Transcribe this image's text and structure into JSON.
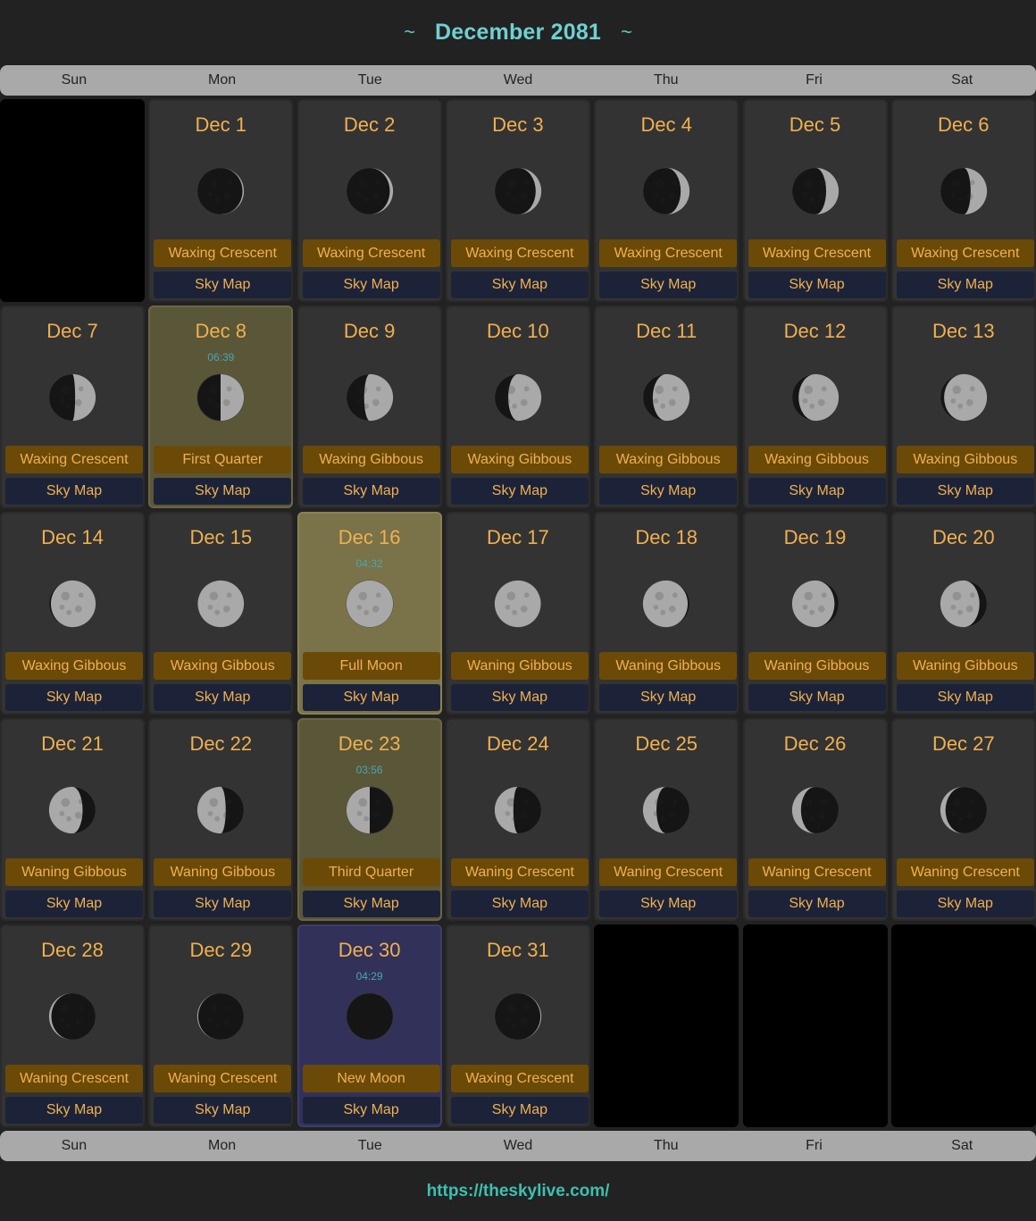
{
  "header": {
    "tilde_left": "~",
    "title": "December 2081",
    "tilde_right": "~"
  },
  "weekdays": [
    "Sun",
    "Mon",
    "Tue",
    "Wed",
    "Thu",
    "Fri",
    "Sat"
  ],
  "sky_map_label": "Sky Map",
  "footer": {
    "link_text": "https://theskylive.com/"
  },
  "colors": {
    "date_text": "#f0b050",
    "time_text": "#4aa6b0",
    "quarter_bg": "#5a5638",
    "full_bg": "#7a7248",
    "new_bg": "#32315a",
    "phase_bg": "#6b4a07",
    "skymap_bg": "#1c2338"
  },
  "days": [
    {
      "date": "Dec 1",
      "phase": "Waxing Crescent",
      "illum": 0.03,
      "dir": "waxing"
    },
    {
      "date": "Dec 2",
      "phase": "Waxing Crescent",
      "illum": 0.07,
      "dir": "waxing"
    },
    {
      "date": "Dec 3",
      "phase": "Waxing Crescent",
      "illum": 0.12,
      "dir": "waxing"
    },
    {
      "date": "Dec 4",
      "phase": "Waxing Crescent",
      "illum": 0.19,
      "dir": "waxing"
    },
    {
      "date": "Dec 5",
      "phase": "Waxing Crescent",
      "illum": 0.27,
      "dir": "waxing"
    },
    {
      "date": "Dec 6",
      "phase": "Waxing Crescent",
      "illum": 0.35,
      "dir": "waxing"
    },
    {
      "date": "Dec 7",
      "phase": "Waxing Crescent",
      "illum": 0.44,
      "dir": "waxing"
    },
    {
      "date": "Dec 8",
      "phase": "First Quarter",
      "time": "06:39",
      "illum": 0.5,
      "dir": "waxing",
      "highlight": "quarter"
    },
    {
      "date": "Dec 9",
      "phase": "Waxing Gibbous",
      "illum": 0.62,
      "dir": "waxing"
    },
    {
      "date": "Dec 10",
      "phase": "Waxing Gibbous",
      "illum": 0.71,
      "dir": "waxing"
    },
    {
      "date": "Dec 11",
      "phase": "Waxing Gibbous",
      "illum": 0.79,
      "dir": "waxing"
    },
    {
      "date": "Dec 12",
      "phase": "Waxing Gibbous",
      "illum": 0.86,
      "dir": "waxing"
    },
    {
      "date": "Dec 13",
      "phase": "Waxing Gibbous",
      "illum": 0.92,
      "dir": "waxing"
    },
    {
      "date": "Dec 14",
      "phase": "Waxing Gibbous",
      "illum": 0.96,
      "dir": "waxing"
    },
    {
      "date": "Dec 15",
      "phase": "Waxing Gibbous",
      "illum": 0.99,
      "dir": "waxing"
    },
    {
      "date": "Dec 16",
      "phase": "Full Moon",
      "time": "04:32",
      "illum": 1.0,
      "dir": "waxing",
      "highlight": "full"
    },
    {
      "date": "Dec 17",
      "phase": "Waning Gibbous",
      "illum": 0.99,
      "dir": "waning"
    },
    {
      "date": "Dec 18",
      "phase": "Waning Gibbous",
      "illum": 0.96,
      "dir": "waning"
    },
    {
      "date": "Dec 19",
      "phase": "Waning Gibbous",
      "illum": 0.91,
      "dir": "waning"
    },
    {
      "date": "Dec 20",
      "phase": "Waning Gibbous",
      "illum": 0.84,
      "dir": "waning"
    },
    {
      "date": "Dec 21",
      "phase": "Waning Gibbous",
      "illum": 0.72,
      "dir": "waning"
    },
    {
      "date": "Dec 22",
      "phase": "Waning Gibbous",
      "illum": 0.61,
      "dir": "waning"
    },
    {
      "date": "Dec 23",
      "phase": "Third Quarter",
      "time": "03:56",
      "illum": 0.5,
      "dir": "waning",
      "highlight": "quarter"
    },
    {
      "date": "Dec 24",
      "phase": "Waning Crescent",
      "illum": 0.4,
      "dir": "waning"
    },
    {
      "date": "Dec 25",
      "phase": "Waning Crescent",
      "illum": 0.29,
      "dir": "waning"
    },
    {
      "date": "Dec 26",
      "phase": "Waning Crescent",
      "illum": 0.19,
      "dir": "waning"
    },
    {
      "date": "Dec 27",
      "phase": "Waning Crescent",
      "illum": 0.11,
      "dir": "waning"
    },
    {
      "date": "Dec 28",
      "phase": "Waning Crescent",
      "illum": 0.05,
      "dir": "waning"
    },
    {
      "date": "Dec 29",
      "phase": "Waning Crescent",
      "illum": 0.02,
      "dir": "waning"
    },
    {
      "date": "Dec 30",
      "phase": "New Moon",
      "time": "04:29",
      "illum": 0.0,
      "dir": "waxing",
      "highlight": "new"
    },
    {
      "date": "Dec 31",
      "phase": "Waxing Crescent",
      "illum": 0.02,
      "dir": "waxing"
    }
  ],
  "first_weekday_index": 1,
  "total_cells": 35
}
